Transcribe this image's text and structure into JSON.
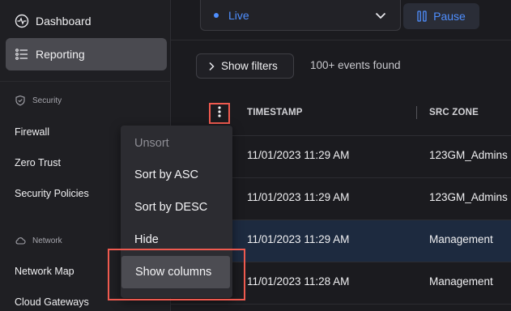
{
  "sidebar": {
    "dashboard": "Dashboard",
    "reporting": "Reporting",
    "security_header": "Security",
    "security_items": [
      "Firewall",
      "Zero Trust",
      "Security Policies"
    ],
    "network_header": "Network",
    "network_items": [
      "Network Map",
      "Cloud Gateways"
    ]
  },
  "topbar": {
    "live_label": "Live",
    "pause_label": "Pause"
  },
  "filters": {
    "show_filters_label": "Show filters",
    "events_found": "100+ events found"
  },
  "table": {
    "columns": [
      "TIMESTAMP",
      "SRC ZONE"
    ],
    "rows": [
      [
        "11/01/2023 11:29 AM",
        "123GM_Admins"
      ],
      [
        "11/01/2023 11:29 AM",
        "123GM_Admins"
      ],
      [
        "11/01/2023 11:29 AM",
        "Management"
      ],
      [
        "11/01/2023 11:28 AM",
        "Management"
      ]
    ]
  },
  "context_menu": {
    "items": [
      "Unsort",
      "Sort by ASC",
      "Sort by DESC",
      "Hide",
      "Show columns"
    ]
  },
  "colors": {
    "accent_blue": "#4f8fff",
    "highlight_red": "#ef5a4f",
    "selected_row": "#1d2a3f"
  }
}
